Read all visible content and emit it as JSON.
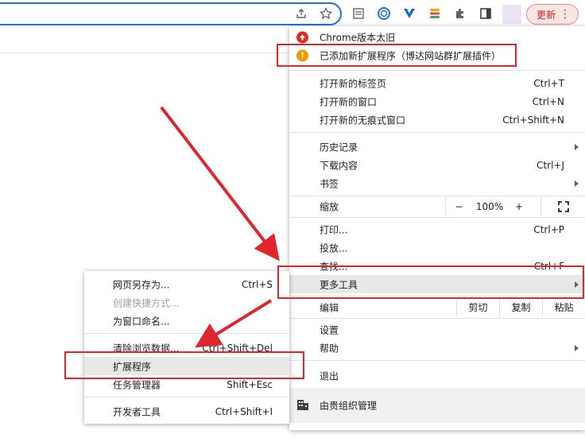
{
  "toolbar": {
    "update_label": "更新",
    "menu_dots": "⋮"
  },
  "menu": {
    "chrome_outdated": "Chrome版本太旧",
    "extension_added": "已添加新扩展程序（博达网站群扩展插件）",
    "new_tab": {
      "label": "打开新的标签页",
      "shortcut": "Ctrl+T"
    },
    "new_window": {
      "label": "打开新的窗口",
      "shortcut": "Ctrl+N"
    },
    "new_incognito": {
      "label": "打开新的无痕式窗口",
      "shortcut": "Ctrl+Shift+N"
    },
    "history": {
      "label": "历史记录"
    },
    "downloads": {
      "label": "下载内容",
      "shortcut": "Ctrl+J"
    },
    "bookmarks": {
      "label": "书签"
    },
    "zoom": {
      "label": "缩放",
      "minus": "−",
      "value": "100%",
      "plus": "+"
    },
    "print": {
      "label": "打印...",
      "shortcut": "Ctrl+P"
    },
    "cast": {
      "label": "投放..."
    },
    "find": {
      "label": "查找...",
      "shortcut": "Ctrl+F"
    },
    "more_tools": {
      "label": "更多工具"
    },
    "edit": {
      "label": "编辑",
      "cut": "剪切",
      "copy": "复制",
      "paste": "粘贴"
    },
    "settings": {
      "label": "设置"
    },
    "help": {
      "label": "帮助"
    },
    "exit": {
      "label": "退出"
    },
    "managed": {
      "label": "由贵组织管理"
    }
  },
  "submenu": {
    "save_page": {
      "label": "网页另存为...",
      "shortcut": "Ctrl+S"
    },
    "create_shortcut": {
      "label": "创建快捷方式..."
    },
    "name_window": {
      "label": "为窗口命名..."
    },
    "clear_data": {
      "label": "清除浏览数据...",
      "shortcut": "Ctrl+Shift+Del"
    },
    "extensions": {
      "label": "扩展程序"
    },
    "task_manager": {
      "label": "任务管理器",
      "shortcut": "Shift+Esc"
    },
    "dev_tools": {
      "label": "开发者工具",
      "shortcut": "Ctrl+Shift+I"
    }
  },
  "colors": {
    "accent_blue": "#1a73e8",
    "update_red": "#c5221f",
    "annotation_red": "#e0262d",
    "warning_orange": "#f29900",
    "highlight_grey": "#e8e8e8"
  }
}
